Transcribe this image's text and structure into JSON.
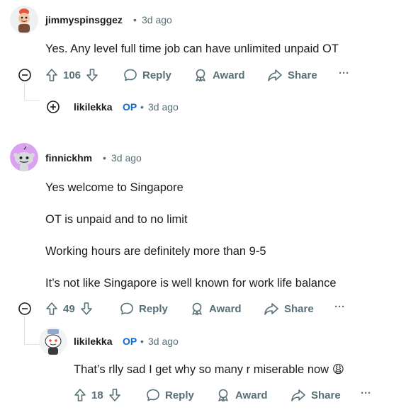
{
  "comments": [
    {
      "author": "jimmyspinsggez",
      "time": "3d ago",
      "body": [
        "Yes. Any level full time job can have unlimited unpaid OT"
      ],
      "votes": "106",
      "reply_label": "Reply",
      "award_label": "Award",
      "share_label": "Share",
      "more_label": "···"
    },
    {
      "author": "likilekka",
      "op_badge": "OP",
      "time": "3d ago",
      "collapsed": true
    },
    {
      "author": "finnickhm",
      "time": "3d ago",
      "body": [
        "Yes welcome to Singapore",
        "OT is unpaid and to no limit",
        "Working hours are definitely more than 9-5",
        "It’s not like Singapore is well known for work life balance"
      ],
      "votes": "49",
      "reply_label": "Reply",
      "award_label": "Award",
      "share_label": "Share",
      "more_label": "···"
    },
    {
      "author": "likilekka",
      "op_badge": "OP",
      "time": "3d ago",
      "body": [
        "That’s rlly sad I get why so many r miserable now"
      ],
      "emoji": "😩",
      "votes": "18",
      "reply_label": "Reply",
      "award_label": "Award",
      "share_label": "Share",
      "more_label": "···"
    }
  ],
  "separator": "•",
  "colors": {
    "text": "#1c1c1c",
    "meta": "#576f76",
    "op": "#0a6ad6",
    "thread_line": "#dfe3e5"
  }
}
